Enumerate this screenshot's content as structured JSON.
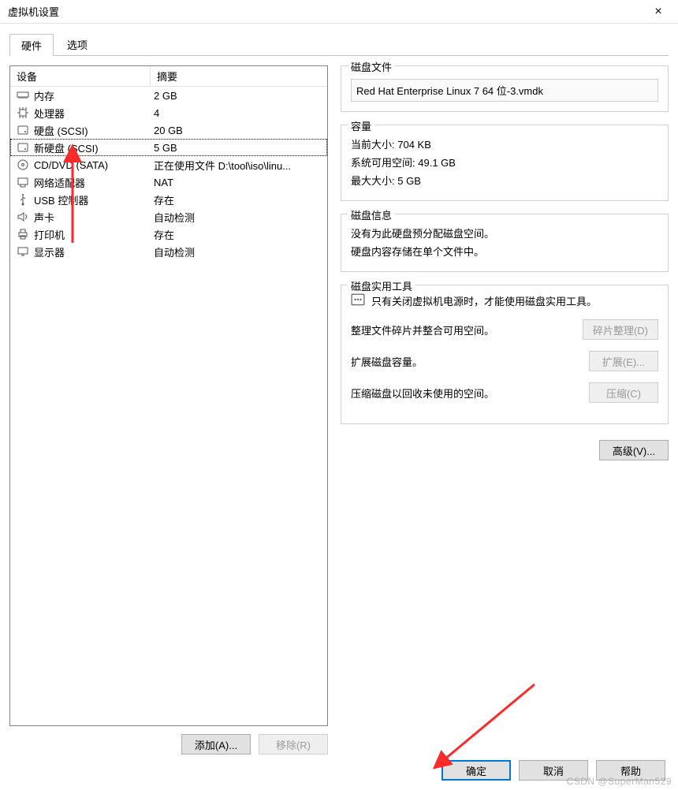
{
  "window": {
    "title": "虚拟机设置"
  },
  "tabs": {
    "hardware": "硬件",
    "options": "选项"
  },
  "list": {
    "head_device": "设备",
    "head_summary": "摘要",
    "rows": [
      {
        "name": "内存",
        "summary": "2 GB",
        "icon": "memory"
      },
      {
        "name": "处理器",
        "summary": "4",
        "icon": "cpu"
      },
      {
        "name": "硬盘 (SCSI)",
        "summary": "20 GB",
        "icon": "disk"
      },
      {
        "name": "新硬盘 (SCSI)",
        "summary": "5 GB",
        "icon": "disk",
        "selected": true
      },
      {
        "name": "CD/DVD (SATA)",
        "summary": "正在使用文件 D:\\tool\\iso\\linu...",
        "icon": "cd"
      },
      {
        "name": "网络适配器",
        "summary": "NAT",
        "icon": "nic"
      },
      {
        "name": "USB 控制器",
        "summary": "存在",
        "icon": "usb"
      },
      {
        "name": "声卡",
        "summary": "自动检测",
        "icon": "audio"
      },
      {
        "name": "打印机",
        "summary": "存在",
        "icon": "printer"
      },
      {
        "name": "显示器",
        "summary": "自动检测",
        "icon": "display"
      }
    ],
    "add": "添加(A)...",
    "remove": "移除(R)"
  },
  "right": {
    "disk_file_title": "磁盘文件",
    "disk_file_value": "Red Hat Enterprise Linux 7 64 位-3.vmdk",
    "capacity_title": "容量",
    "cap_current_label": "当前大小:",
    "cap_current_value": "704 KB",
    "cap_free_label": "系统可用空间:",
    "cap_free_value": "49.1 GB",
    "cap_max_label": "最大大小:",
    "cap_max_value": "5 GB",
    "info_title": "磁盘信息",
    "info_line1": "没有为此硬盘预分配磁盘空间。",
    "info_line2": "硬盘内容存储在单个文件中。",
    "util_title": "磁盘实用工具",
    "util_tip": "只有关闭虚拟机电源时，才能使用磁盘实用工具。",
    "util_defrag_text": "整理文件碎片并整合可用空间。",
    "util_defrag_btn": "碎片整理(D)",
    "util_expand_text": "扩展磁盘容量。",
    "util_expand_btn": "扩展(E)...",
    "util_compact_text": "压缩磁盘以回收未使用的空间。",
    "util_compact_btn": "压缩(C)",
    "advanced_btn": "高级(V)..."
  },
  "footer": {
    "ok": "确定",
    "cancel": "取消",
    "help": "帮助"
  },
  "watermark": "CSDN @SuperMan529"
}
